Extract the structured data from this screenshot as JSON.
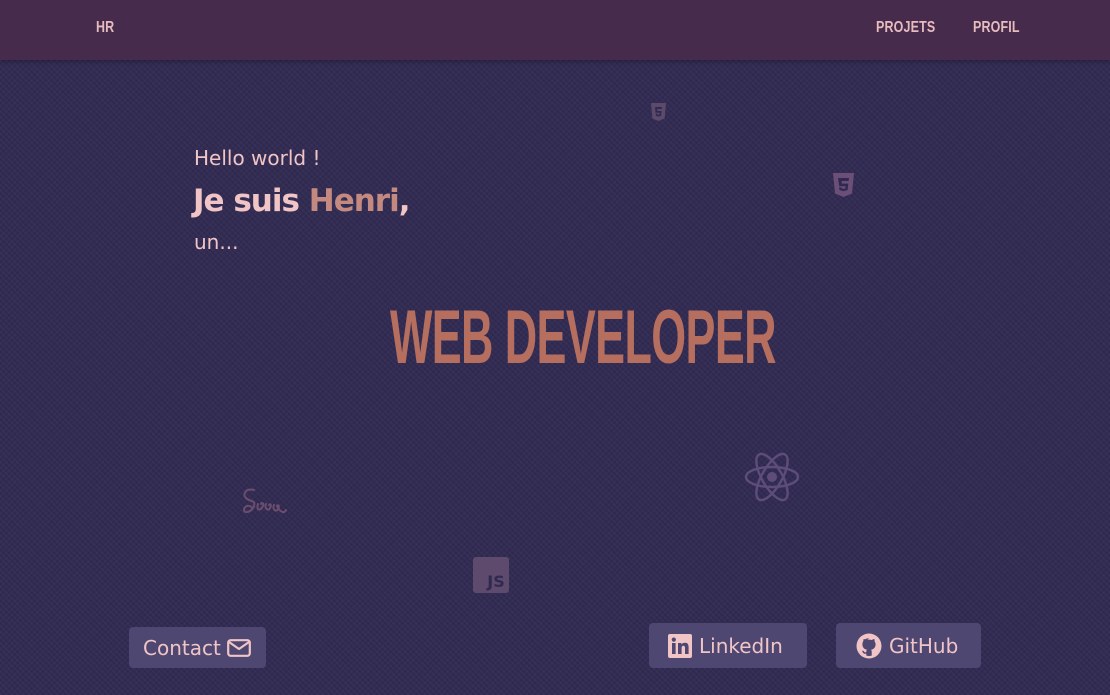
{
  "nav": {
    "logo": "HR",
    "links": [
      "PROJETS",
      "PROFIL"
    ]
  },
  "hero": {
    "greeting": "Hello world !",
    "intro_prefix": "Je suis ",
    "intro_name": "Henri",
    "intro_suffix": ",",
    "subline": "un...",
    "headline": "WEB DEVELOPER"
  },
  "buttons": {
    "contact": "Contact",
    "linkedin": "LinkedIn",
    "github": "GitHub"
  },
  "decorations": {
    "js_label": "JS",
    "icons": [
      "html5-icon",
      "css3-icon",
      "react-icon",
      "sass-icon",
      "javascript-icon"
    ]
  },
  "colors": {
    "background": "#302a52",
    "navbar": "#472b4c",
    "accent": "#b66e5e",
    "text": "#f1c4c6",
    "button": "#4d4772"
  }
}
